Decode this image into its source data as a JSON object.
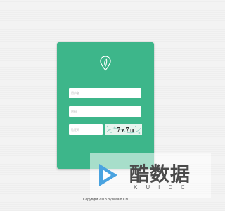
{
  "login": {
    "username_placeholder": "用户名",
    "password_placeholder": "密码",
    "captcha_placeholder": "验证码",
    "captcha_text": "7z7u"
  },
  "footer": {
    "copyright": "Copyright 2018 by Maald.CN"
  },
  "watermark": {
    "text_cn": "酷数据",
    "text_en": "KUIDC"
  },
  "colors": {
    "card": "#3db68a",
    "background": "#f3f3f3",
    "accent": "#4aa3e0"
  },
  "icons": {
    "logo": "location-pin-leaf-icon",
    "watermark": "play-logo-icon"
  }
}
